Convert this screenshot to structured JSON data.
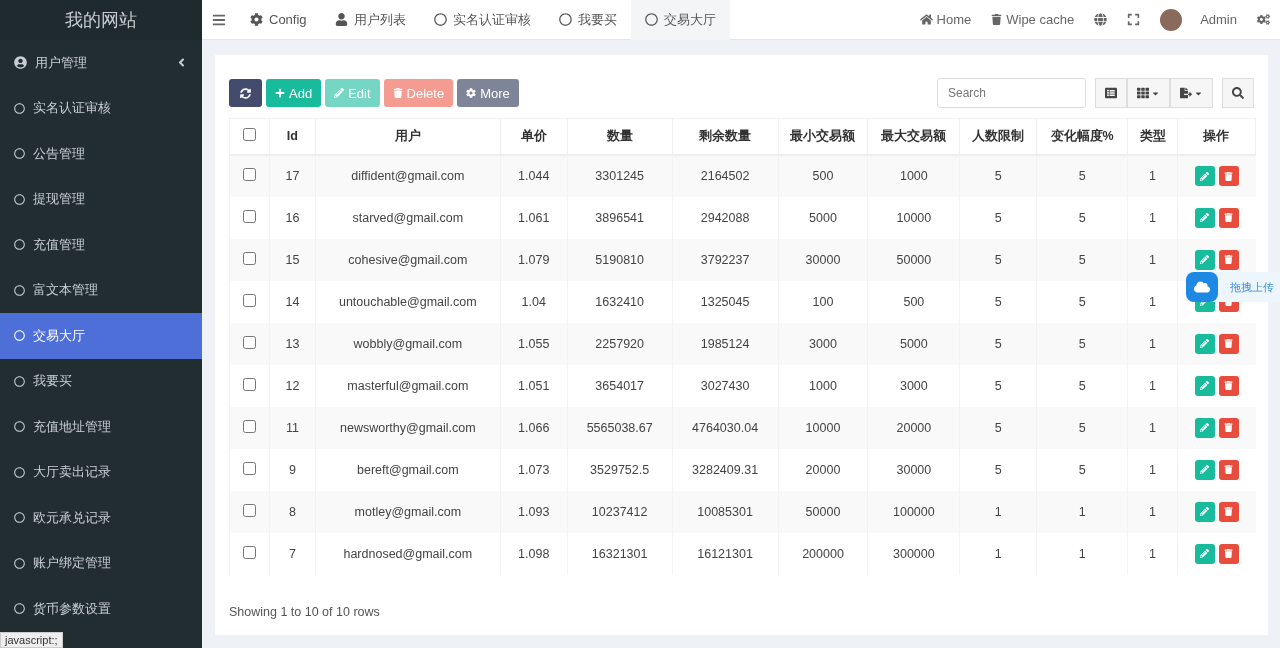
{
  "sidebar": {
    "title": "我的网站",
    "items": [
      {
        "label": "用户管理",
        "selected": false,
        "kind": "group"
      },
      {
        "label": "实名认证审核",
        "selected": false,
        "kind": "link"
      },
      {
        "label": "公告管理",
        "selected": false,
        "kind": "link"
      },
      {
        "label": "提现管理",
        "selected": false,
        "kind": "link"
      },
      {
        "label": "充值管理",
        "selected": false,
        "kind": "link"
      },
      {
        "label": "富文本管理",
        "selected": false,
        "kind": "link"
      },
      {
        "label": "交易大厅",
        "selected": true,
        "kind": "link"
      },
      {
        "label": "我要买",
        "selected": false,
        "kind": "link"
      },
      {
        "label": "充值地址管理",
        "selected": false,
        "kind": "link"
      },
      {
        "label": "大厅卖出记录",
        "selected": false,
        "kind": "link"
      },
      {
        "label": "欧元承兑记录",
        "selected": false,
        "kind": "link"
      },
      {
        "label": "账户绑定管理",
        "selected": false,
        "kind": "link"
      },
      {
        "label": "货币参数设置",
        "selected": false,
        "kind": "link"
      }
    ]
  },
  "status_bar": "javascript:;",
  "tabs": [
    {
      "label": "Config",
      "kind": "gear",
      "selected": false
    },
    {
      "label": "用户列表",
      "kind": "user",
      "selected": false
    },
    {
      "label": "实名认证审核",
      "kind": "circle",
      "selected": false
    },
    {
      "label": "我要买",
      "kind": "circle",
      "selected": false
    },
    {
      "label": "交易大厅",
      "kind": "circle",
      "selected": true
    }
  ],
  "header_right": {
    "home": "Home",
    "wipe": "Wipe cache",
    "user": "Admin"
  },
  "toolbar": {
    "add": "Add",
    "edit": "Edit",
    "delete": "Delete",
    "more": "More",
    "search_placeholder": "Search"
  },
  "table": {
    "header_checked": false,
    "columns": [
      "Id",
      "用户",
      "单价",
      "数量",
      "剩余数量",
      "最小交易额",
      "最大交易额",
      "人数限制",
      "变化幅度%",
      "类型",
      "操作"
    ],
    "rows": [
      {
        "checked": false,
        "cells": [
          "17",
          "diffident@gmail.com",
          "1.044",
          "3301245",
          "2164502",
          "500",
          "1000",
          "5",
          "5",
          "1"
        ]
      },
      {
        "checked": false,
        "cells": [
          "16",
          "starved@gmail.com",
          "1.061",
          "3896541",
          "2942088",
          "5000",
          "10000",
          "5",
          "5",
          "1"
        ]
      },
      {
        "checked": false,
        "cells": [
          "15",
          "cohesive@gmail.com",
          "1.079",
          "5190810",
          "3792237",
          "30000",
          "50000",
          "5",
          "5",
          "1"
        ]
      },
      {
        "checked": false,
        "cells": [
          "14",
          "untouchable@gmail.com",
          "1.04",
          "1632410",
          "1325045",
          "100",
          "500",
          "5",
          "5",
          "1"
        ]
      },
      {
        "checked": false,
        "cells": [
          "13",
          "wobbly@gmail.com",
          "1.055",
          "2257920",
          "1985124",
          "3000",
          "5000",
          "5",
          "5",
          "1"
        ]
      },
      {
        "checked": false,
        "cells": [
          "12",
          "masterful@gmail.com",
          "1.051",
          "3654017",
          "3027430",
          "1000",
          "3000",
          "5",
          "5",
          "1"
        ]
      },
      {
        "checked": false,
        "cells": [
          "11",
          "newsworthy@gmail.com",
          "1.066",
          "5565038.67",
          "4764030.04",
          "10000",
          "20000",
          "5",
          "5",
          "1"
        ]
      },
      {
        "checked": false,
        "cells": [
          "9",
          "bereft@gmail.com",
          "1.073",
          "3529752.5",
          "3282409.31",
          "20000",
          "30000",
          "5",
          "5",
          "1"
        ]
      },
      {
        "checked": false,
        "cells": [
          "8",
          "motley@gmail.com",
          "1.093",
          "10237412",
          "10085301",
          "50000",
          "100000",
          "1",
          "1",
          "1"
        ]
      },
      {
        "checked": false,
        "cells": [
          "7",
          "hardnosed@gmail.com",
          "1.098",
          "16321301",
          "16121301",
          "200000",
          "300000",
          "1",
          "1",
          "1"
        ]
      }
    ]
  },
  "pagination_info": "Showing 1 to 10 of 10 rows",
  "upload_widget": "拖拽上传"
}
